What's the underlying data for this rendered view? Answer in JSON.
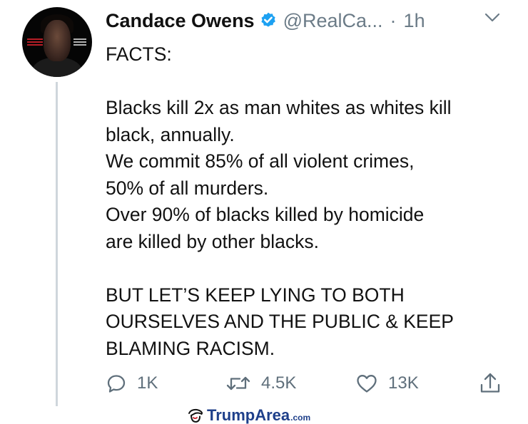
{
  "tweet": {
    "author_name": "Candace Owens",
    "handle": "@RealCa...",
    "separator": "·",
    "time": "1h",
    "verified": true,
    "body_lines": [
      "FACTS:",
      "",
      "Blacks kill 2x as man whites as whites kill",
      "black, annually.",
      "We commit 85% of all violent crimes,",
      "50% of all murders.",
      "Over 90% of blacks killed by homicide",
      "are killed by other blacks.",
      "",
      "BUT LET’S KEEP LYING TO BOTH",
      "OURSELVES AND THE PUBLIC & KEEP",
      "BLAMING RACISM."
    ],
    "actions": {
      "reply_count": "1K",
      "retweet_count": "4.5K",
      "like_count": "13K"
    }
  },
  "watermark": {
    "name": "TrumpArea",
    "tld": ".com"
  },
  "icons": {
    "verified": "verified-badge-icon",
    "menu": "chevron-down-icon",
    "reply": "reply-icon",
    "retweet": "retweet-icon",
    "like": "heart-icon",
    "share": "share-icon",
    "watermark": "trump-hair-icon"
  },
  "colors": {
    "verified_blue": "#1da1f2",
    "muted_text": "#6b7b87",
    "thread_line": "#cfd6dc",
    "watermark_blue": "#1e3f8a",
    "watermark_red": "#c9202a"
  }
}
